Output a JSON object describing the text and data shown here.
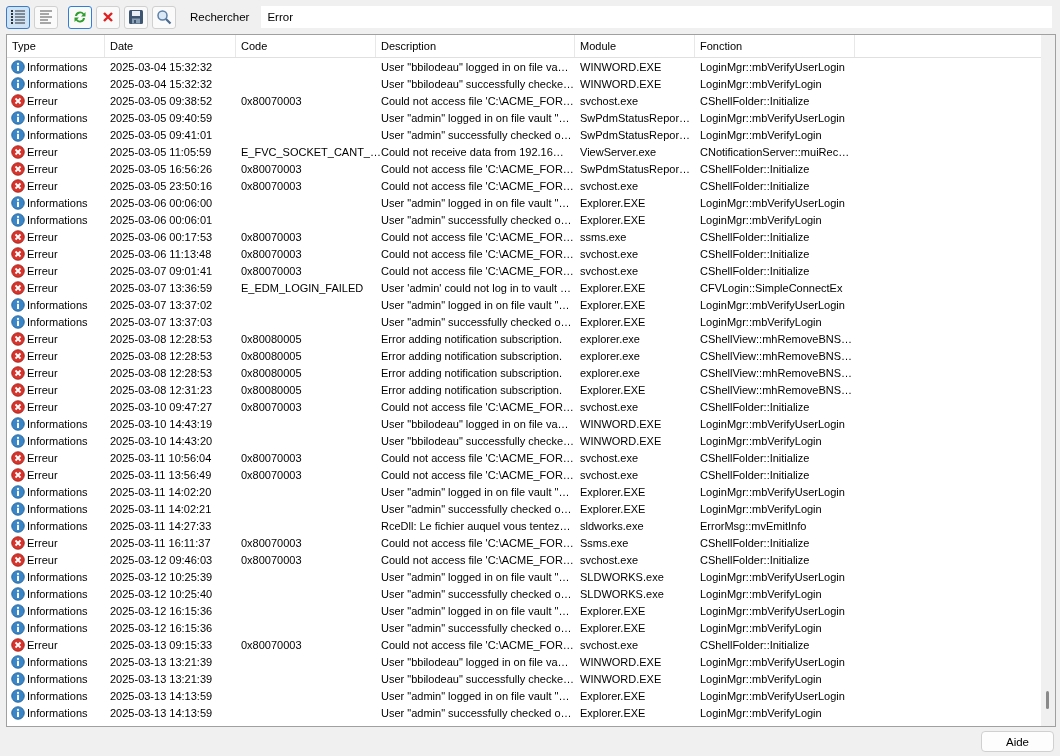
{
  "toolbar": {
    "view_buttons": [
      {
        "kind": "list",
        "selected": true
      },
      {
        "kind": "text",
        "selected": false
      }
    ],
    "actions": [
      {
        "kind": "refresh"
      },
      {
        "kind": "delete"
      },
      {
        "kind": "save"
      },
      {
        "kind": "search"
      }
    ],
    "search_label": "Rechercher",
    "search_value": "Error"
  },
  "table": {
    "columns": [
      "Type",
      "Date",
      "Code",
      "Description",
      "Module",
      "Fonction"
    ],
    "rows": [
      {
        "kind": "info",
        "type": "Informations",
        "date": "2025-03-04 15:32:32",
        "description": "User \"bbilodeau\" logged in on file va…",
        "module": "WINWORD.EXE",
        "function": "LoginMgr::mbVerifyUserLogin"
      },
      {
        "kind": "info",
        "type": "Informations",
        "date": "2025-03-04 15:32:32",
        "description": "User \"bbilodeau\" successfully checke…",
        "module": "WINWORD.EXE",
        "function": "LoginMgr::mbVerifyLogin"
      },
      {
        "kind": "error",
        "type": "Erreur",
        "date": "2025-03-05 09:38:52",
        "code": "0x80070003",
        "description": "Could not access file 'C:\\ACME_FOR…",
        "module": "svchost.exe",
        "function": "CShellFolder::Initialize"
      },
      {
        "kind": "info",
        "type": "Informations",
        "date": "2025-03-05 09:40:59",
        "description": "User \"admin\" logged in on file vault \"…",
        "module": "SwPdmStatusRepor…",
        "function": "LoginMgr::mbVerifyUserLogin"
      },
      {
        "kind": "info",
        "type": "Informations",
        "date": "2025-03-05 09:41:01",
        "description": "User \"admin\" successfully checked o…",
        "module": "SwPdmStatusRepor…",
        "function": "LoginMgr::mbVerifyLogin"
      },
      {
        "kind": "error",
        "type": "Erreur",
        "date": "2025-03-05 11:05:59",
        "code": "E_FVC_SOCKET_CANT_…",
        "description": "Could not receive data from 192.16…",
        "module": "ViewServer.exe",
        "function": "CNotificationServer::muiRec…"
      },
      {
        "kind": "error",
        "type": "Erreur",
        "date": "2025-03-05 16:56:26",
        "code": "0x80070003",
        "description": "Could not access file 'C:\\ACME_FOR…",
        "module": "SwPdmStatusRepor…",
        "function": "CShellFolder::Initialize"
      },
      {
        "kind": "error",
        "type": "Erreur",
        "date": "2025-03-05 23:50:16",
        "code": "0x80070003",
        "description": "Could not access file 'C:\\ACME_FOR…",
        "module": "svchost.exe",
        "function": "CShellFolder::Initialize"
      },
      {
        "kind": "info",
        "type": "Informations",
        "date": "2025-03-06 00:06:00",
        "description": "User \"admin\" logged in on file vault \"…",
        "module": "Explorer.EXE",
        "function": "LoginMgr::mbVerifyUserLogin"
      },
      {
        "kind": "info",
        "type": "Informations",
        "date": "2025-03-06 00:06:01",
        "description": "User \"admin\" successfully checked o…",
        "module": "Explorer.EXE",
        "function": "LoginMgr::mbVerifyLogin"
      },
      {
        "kind": "error",
        "type": "Erreur",
        "date": "2025-03-06 00:17:53",
        "code": "0x80070003",
        "description": "Could not access file 'C:\\ACME_FOR…",
        "module": "ssms.exe",
        "function": "CShellFolder::Initialize"
      },
      {
        "kind": "error",
        "type": "Erreur",
        "date": "2025-03-06 11:13:48",
        "code": "0x80070003",
        "description": "Could not access file 'C:\\ACME_FOR…",
        "module": "svchost.exe",
        "function": "CShellFolder::Initialize"
      },
      {
        "kind": "error",
        "type": "Erreur",
        "date": "2025-03-07 09:01:41",
        "code": "0x80070003",
        "description": "Could not access file 'C:\\ACME_FOR…",
        "module": "svchost.exe",
        "function": "CShellFolder::Initialize"
      },
      {
        "kind": "error",
        "type": "Erreur",
        "date": "2025-03-07 13:36:59",
        "code": "E_EDM_LOGIN_FAILED",
        "description": "User 'admin' could not log in to vault …",
        "module": "Explorer.EXE",
        "function": "CFVLogin::SimpleConnectEx"
      },
      {
        "kind": "info",
        "type": "Informations",
        "date": "2025-03-07 13:37:02",
        "description": "User \"admin\" logged in on file vault \"…",
        "module": "Explorer.EXE",
        "function": "LoginMgr::mbVerifyUserLogin"
      },
      {
        "kind": "info",
        "type": "Informations",
        "date": "2025-03-07 13:37:03",
        "description": "User \"admin\" successfully checked o…",
        "module": "Explorer.EXE",
        "function": "LoginMgr::mbVerifyLogin"
      },
      {
        "kind": "error",
        "type": "Erreur",
        "date": "2025-03-08 12:28:53",
        "code": "0x80080005",
        "description": "Error adding notification subscription.",
        "module": "explorer.exe",
        "function": "CShellView::mhRemoveBNS…"
      },
      {
        "kind": "error",
        "type": "Erreur",
        "date": "2025-03-08 12:28:53",
        "code": "0x80080005",
        "description": "Error adding notification subscription.",
        "module": "explorer.exe",
        "function": "CShellView::mhRemoveBNS…"
      },
      {
        "kind": "error",
        "type": "Erreur",
        "date": "2025-03-08 12:28:53",
        "code": "0x80080005",
        "description": "Error adding notification subscription.",
        "module": "explorer.exe",
        "function": "CShellView::mhRemoveBNS…"
      },
      {
        "kind": "error",
        "type": "Erreur",
        "date": "2025-03-08 12:31:23",
        "code": "0x80080005",
        "description": "Error adding notification subscription.",
        "module": "Explorer.EXE",
        "function": "CShellView::mhRemoveBNS…"
      },
      {
        "kind": "error",
        "type": "Erreur",
        "date": "2025-03-10 09:47:27",
        "code": "0x80070003",
        "description": "Could not access file 'C:\\ACME_FOR…",
        "module": "svchost.exe",
        "function": "CShellFolder::Initialize"
      },
      {
        "kind": "info",
        "type": "Informations",
        "date": "2025-03-10 14:43:19",
        "description": "User \"bbilodeau\" logged in on file va…",
        "module": "WINWORD.EXE",
        "function": "LoginMgr::mbVerifyUserLogin"
      },
      {
        "kind": "info",
        "type": "Informations",
        "date": "2025-03-10 14:43:20",
        "description": "User \"bbilodeau\" successfully checke…",
        "module": "WINWORD.EXE",
        "function": "LoginMgr::mbVerifyLogin"
      },
      {
        "kind": "error",
        "type": "Erreur",
        "date": "2025-03-11 10:56:04",
        "code": "0x80070003",
        "description": "Could not access file 'C:\\ACME_FOR…",
        "module": "svchost.exe",
        "function": "CShellFolder::Initialize"
      },
      {
        "kind": "error",
        "type": "Erreur",
        "date": "2025-03-11 13:56:49",
        "code": "0x80070003",
        "description": "Could not access file 'C:\\ACME_FOR…",
        "module": "svchost.exe",
        "function": "CShellFolder::Initialize"
      },
      {
        "kind": "info",
        "type": "Informations",
        "date": "2025-03-11 14:02:20",
        "description": "User \"admin\" logged in on file vault \"…",
        "module": "Explorer.EXE",
        "function": "LoginMgr::mbVerifyUserLogin"
      },
      {
        "kind": "info",
        "type": "Informations",
        "date": "2025-03-11 14:02:21",
        "description": "User \"admin\" successfully checked o…",
        "module": "Explorer.EXE",
        "function": "LoginMgr::mbVerifyLogin"
      },
      {
        "kind": "info",
        "type": "Informations",
        "date": "2025-03-11 14:27:33",
        "description": "RceDll: Le fichier auquel vous tentez…",
        "module": "sldworks.exe",
        "function": "ErrorMsg::mvEmitInfo"
      },
      {
        "kind": "error",
        "type": "Erreur",
        "date": "2025-03-11 16:11:37",
        "code": "0x80070003",
        "description": "Could not access file 'C:\\ACME_FOR…",
        "module": "Ssms.exe",
        "function": "CShellFolder::Initialize"
      },
      {
        "kind": "error",
        "type": "Erreur",
        "date": "2025-03-12 09:46:03",
        "code": "0x80070003",
        "description": "Could not access file 'C:\\ACME_FOR…",
        "module": "svchost.exe",
        "function": "CShellFolder::Initialize"
      },
      {
        "kind": "info",
        "type": "Informations",
        "date": "2025-03-12 10:25:39",
        "description": "User \"admin\" logged in on file vault \"…",
        "module": "SLDWORKS.exe",
        "function": "LoginMgr::mbVerifyUserLogin"
      },
      {
        "kind": "info",
        "type": "Informations",
        "date": "2025-03-12 10:25:40",
        "description": "User \"admin\" successfully checked o…",
        "module": "SLDWORKS.exe",
        "function": "LoginMgr::mbVerifyLogin"
      },
      {
        "kind": "info",
        "type": "Informations",
        "date": "2025-03-12 16:15:36",
        "description": "User \"admin\" logged in on file vault \"…",
        "module": "Explorer.EXE",
        "function": "LoginMgr::mbVerifyUserLogin"
      },
      {
        "kind": "info",
        "type": "Informations",
        "date": "2025-03-12 16:15:36",
        "description": "User \"admin\" successfully checked o…",
        "module": "Explorer.EXE",
        "function": "LoginMgr::mbVerifyLogin"
      },
      {
        "kind": "error",
        "type": "Erreur",
        "date": "2025-03-13 09:15:33",
        "code": "0x80070003",
        "description": "Could not access file 'C:\\ACME_FOR…",
        "module": "svchost.exe",
        "function": "CShellFolder::Initialize"
      },
      {
        "kind": "info",
        "type": "Informations",
        "date": "2025-03-13 13:21:39",
        "description": "User \"bbilodeau\" logged in on file va…",
        "module": "WINWORD.EXE",
        "function": "LoginMgr::mbVerifyUserLogin"
      },
      {
        "kind": "info",
        "type": "Informations",
        "date": "2025-03-13 13:21:39",
        "description": "User \"bbilodeau\" successfully checke…",
        "module": "WINWORD.EXE",
        "function": "LoginMgr::mbVerifyLogin"
      },
      {
        "kind": "info",
        "type": "Informations",
        "date": "2025-03-13 14:13:59",
        "description": "User \"admin\" logged in on file vault \"…",
        "module": "Explorer.EXE",
        "function": "LoginMgr::mbVerifyUserLogin"
      },
      {
        "kind": "info",
        "type": "Informations",
        "date": "2025-03-13 14:13:59",
        "description": "User \"admin\" successfully checked o…",
        "module": "Explorer.EXE",
        "function": "LoginMgr::mbVerifyLogin"
      }
    ]
  },
  "footer": {
    "help_button": "Aide"
  }
}
